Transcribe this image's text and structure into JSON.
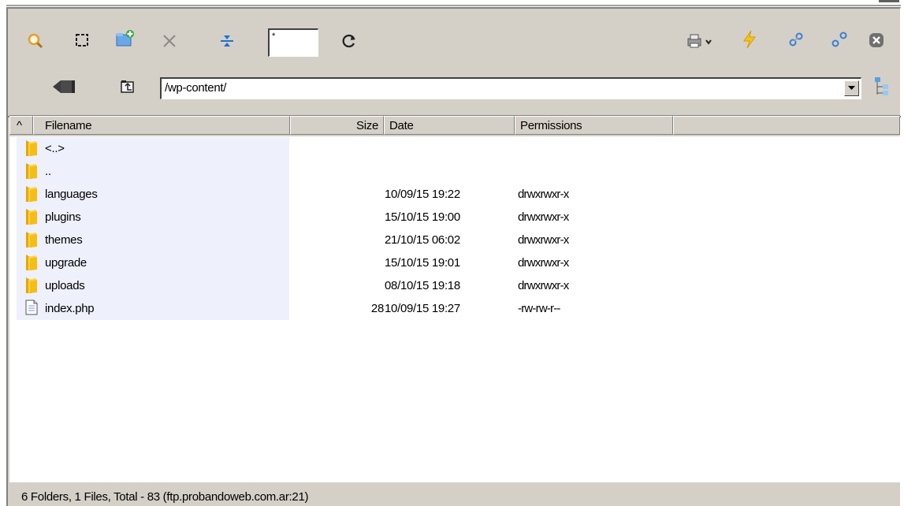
{
  "toolbar": {
    "filter_value": "*",
    "buttons": [
      "search-icon",
      "select-icon",
      "new-folder-icon",
      "delete-icon",
      "split-icon",
      "refresh-icon"
    ],
    "right_buttons": [
      "printer-icon",
      "lightning-icon",
      "connect-icon",
      "disconnect-icon",
      "close-icon"
    ]
  },
  "path": {
    "value": "/wp-content/"
  },
  "list": {
    "columns": {
      "sort_indicator": "^",
      "filename": "Filename",
      "size": "Size",
      "date": "Date",
      "permissions": "Permissions"
    },
    "rows": [
      {
        "type": "folder",
        "name": "<..>",
        "size": "",
        "date": "",
        "perm": ""
      },
      {
        "type": "folder",
        "name": "..",
        "size": "",
        "date": "",
        "perm": ""
      },
      {
        "type": "folder",
        "name": "languages",
        "size": "",
        "date": "10/09/15  19:22",
        "perm": "drwxrwxr-x"
      },
      {
        "type": "folder",
        "name": "plugins",
        "size": "",
        "date": "15/10/15  19:00",
        "perm": "drwxrwxr-x"
      },
      {
        "type": "folder",
        "name": "themes",
        "size": "",
        "date": "21/10/15  06:02",
        "perm": "drwxrwxr-x"
      },
      {
        "type": "folder",
        "name": "upgrade",
        "size": "",
        "date": "15/10/15  19:01",
        "perm": "drwxrwxr-x"
      },
      {
        "type": "folder",
        "name": "uploads",
        "size": "",
        "date": "08/10/15  19:18",
        "perm": "drwxrwxr-x"
      },
      {
        "type": "file",
        "name": "index.php",
        "size": "28",
        "date": "10/09/15  19:27",
        "perm": "-rw-rw-r--"
      }
    ]
  },
  "status": {
    "text": "6 Folders, 1 Files, Total - 83  (ftp.probandoweb.com.ar:21)"
  }
}
